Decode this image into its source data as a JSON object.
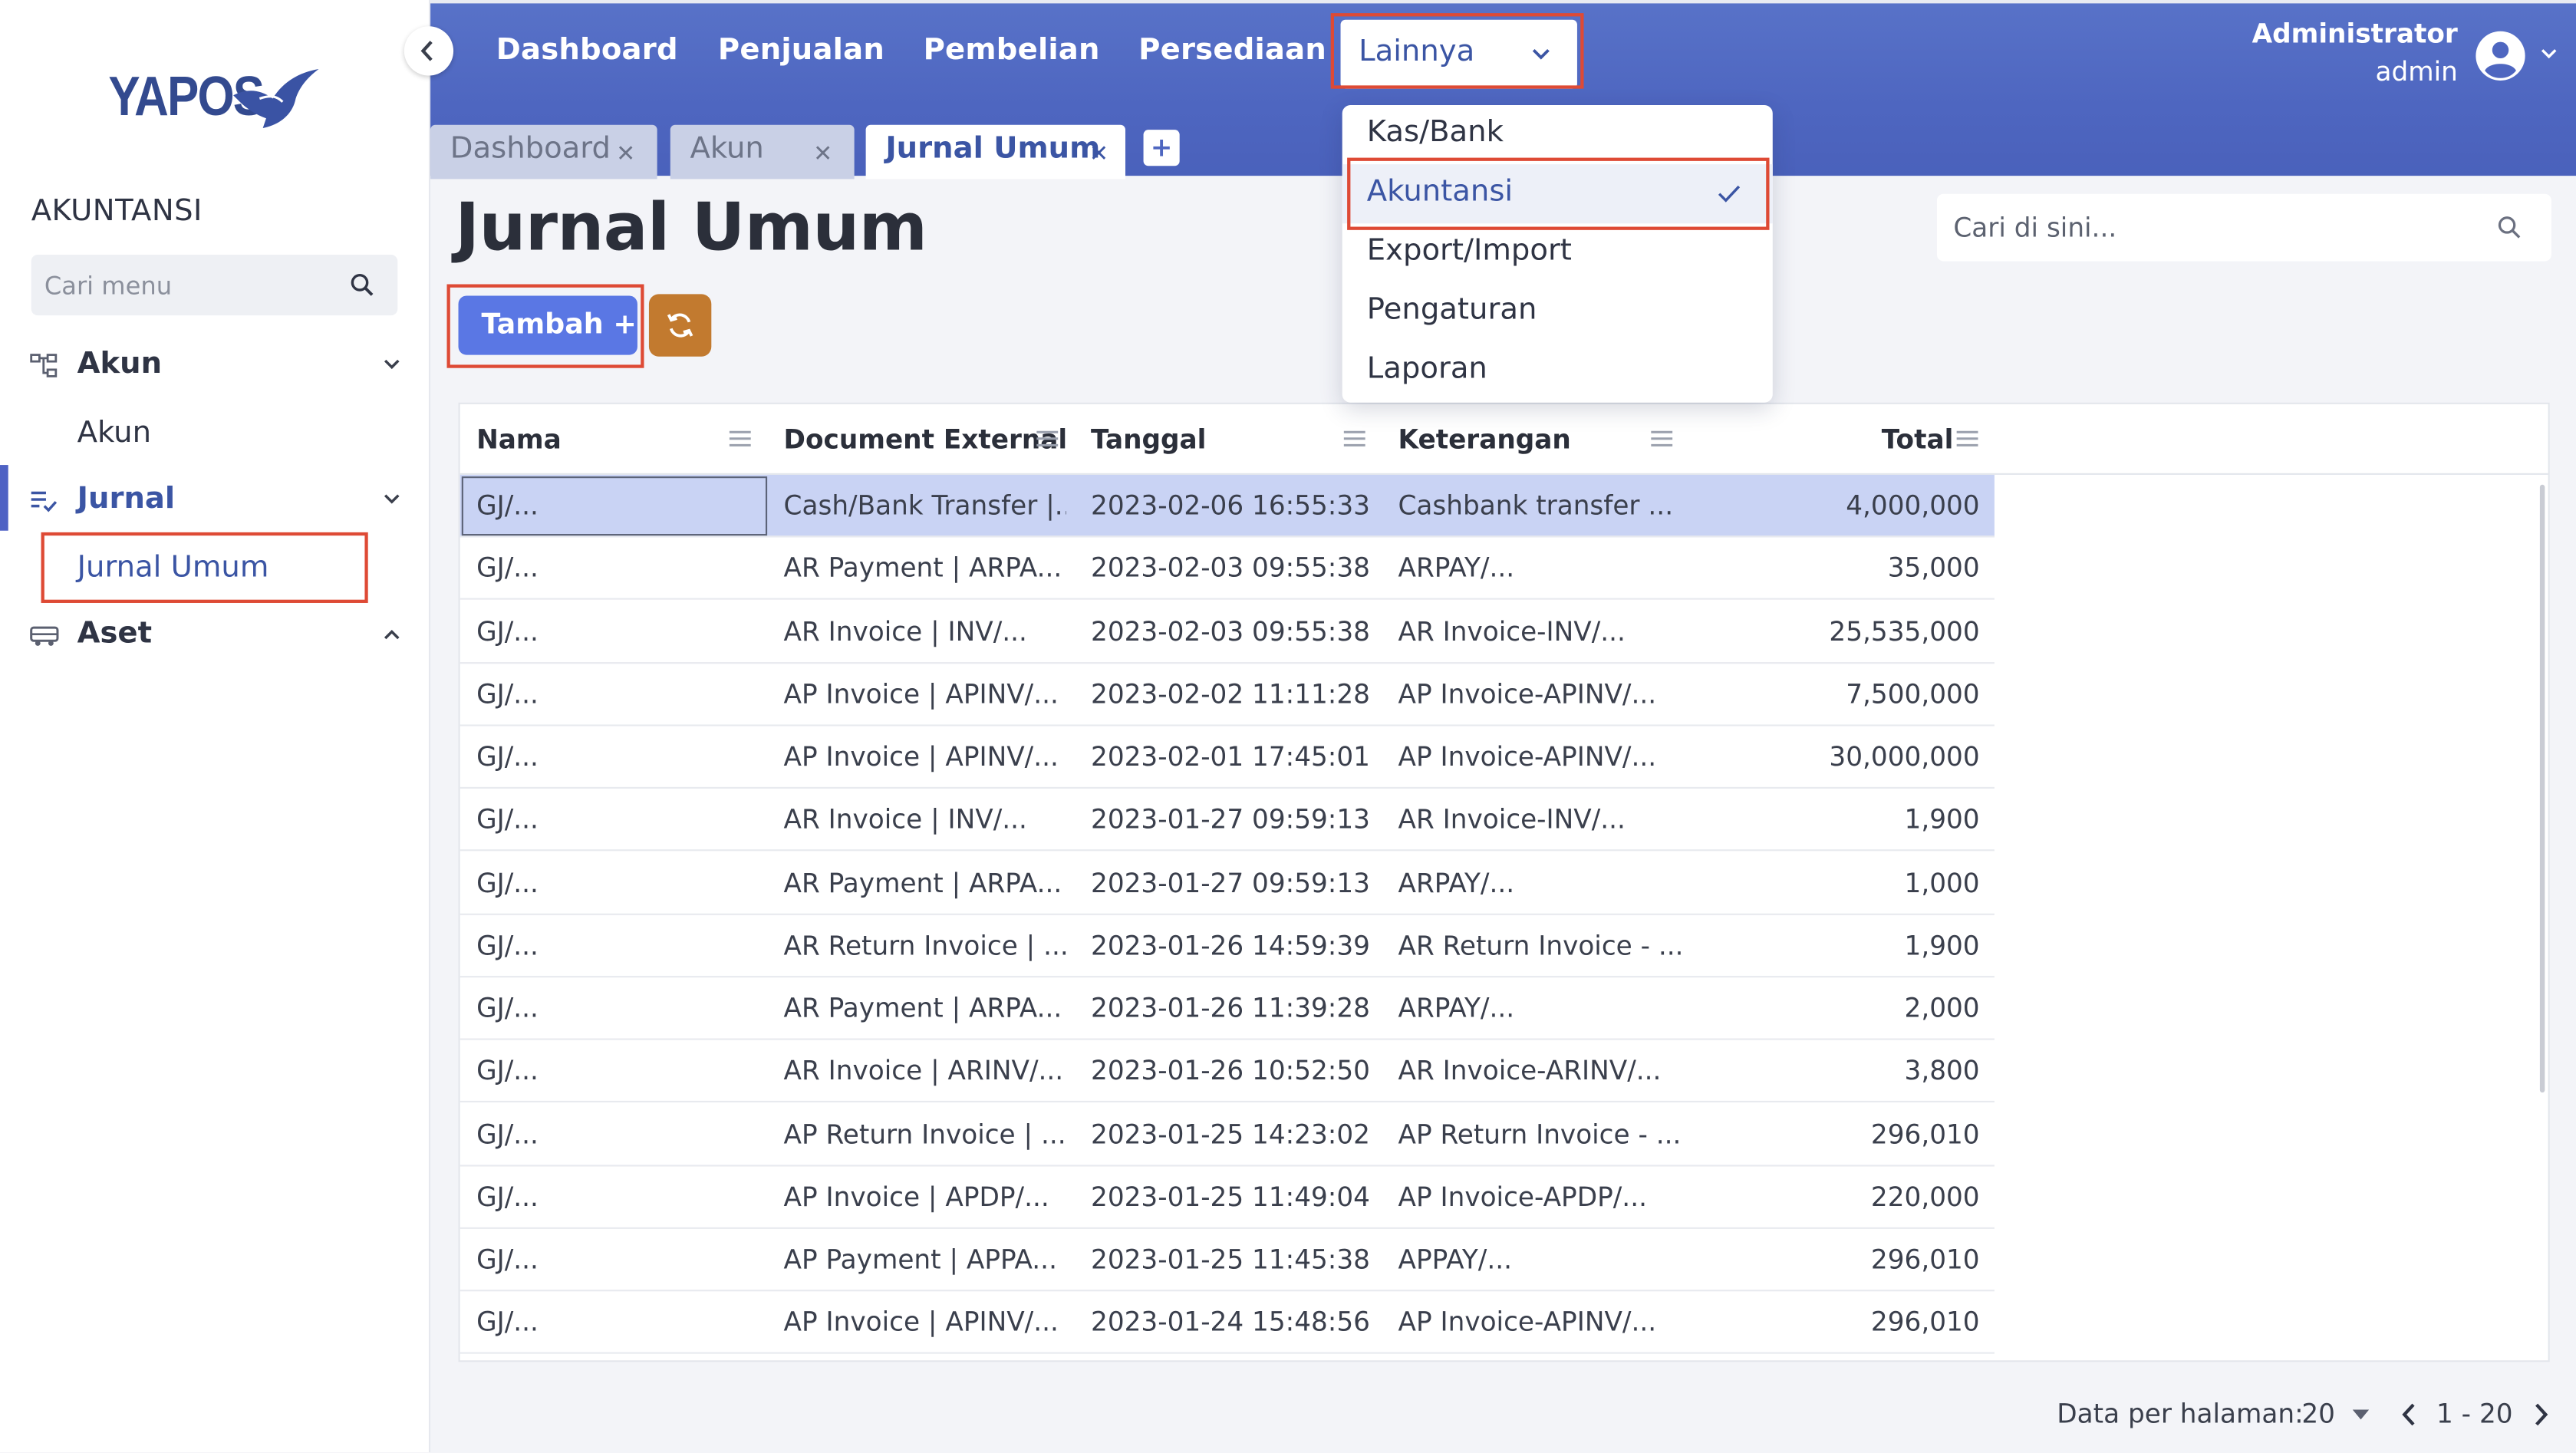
{
  "app": {
    "logo_text": "YAPOS",
    "accent_color": "#4e66c0",
    "highlight_color": "#de4a35"
  },
  "sidebar": {
    "section_title": "AKUNTANSI",
    "search_placeholder": "Cari menu",
    "groups": [
      {
        "label": "Akun",
        "icon": "account-tree-icon",
        "expanded": true,
        "items": [
          {
            "label": "Akun"
          }
        ]
      },
      {
        "label": "Jurnal",
        "icon": "journal-list-icon",
        "expanded": true,
        "active": true,
        "items": [
          {
            "label": "Jurnal Umum",
            "active": true
          }
        ]
      },
      {
        "label": "Aset",
        "icon": "vehicle-icon",
        "expanded": false,
        "items": []
      }
    ]
  },
  "topbar": {
    "nav": [
      "Dashboard",
      "Penjualan",
      "Pembelian",
      "Persediaan"
    ],
    "more_label": "Lainnya",
    "user": {
      "name": "Administrator",
      "role": "admin"
    }
  },
  "dropdown": {
    "items": [
      {
        "label": "Kas/Bank"
      },
      {
        "label": "Akuntansi",
        "selected": true
      },
      {
        "label": "Export/Import"
      },
      {
        "label": "Pengaturan"
      },
      {
        "label": "Laporan"
      }
    ]
  },
  "tabs": [
    {
      "label": "Dashboard",
      "active": false
    },
    {
      "label": "Akun",
      "active": false
    },
    {
      "label": "Jurnal Umum",
      "active": true
    }
  ],
  "main": {
    "title": "Jurnal Umum",
    "add_button": "Tambah +",
    "search_placeholder": "Cari di sini..."
  },
  "table": {
    "columns": [
      "Nama",
      "Document External",
      "Tanggal",
      "Keterangan",
      "Total"
    ],
    "rows": [
      [
        "GJ/...",
        "Cash/Bank Transfer |...",
        "2023-02-06 16:55:33",
        "Cashbank transfer ...",
        "4,000,000"
      ],
      [
        "GJ/...",
        "AR Payment | ARPA...",
        "2023-02-03 09:55:38",
        "ARPAY/...",
        "35,000"
      ],
      [
        "GJ/...",
        "AR Invoice | INV/...",
        "2023-02-03 09:55:38",
        "AR Invoice-INV/...",
        "25,535,000"
      ],
      [
        "GJ/...",
        "AP Invoice | APINV/...",
        "2023-02-02 11:11:28",
        "AP Invoice-APINV/...",
        "7,500,000"
      ],
      [
        "GJ/...",
        "AP Invoice | APINV/...",
        "2023-02-01 17:45:01",
        "AP Invoice-APINV/...",
        "30,000,000"
      ],
      [
        "GJ/...",
        "AR Invoice | INV/...",
        "2023-01-27 09:59:13",
        "AR Invoice-INV/...",
        "1,900"
      ],
      [
        "GJ/...",
        "AR Payment | ARPA...",
        "2023-01-27 09:59:13",
        "ARPAY/...",
        "1,000"
      ],
      [
        "GJ/...",
        "AR Return Invoice | ...",
        "2023-01-26 14:59:39",
        "AR Return Invoice - ...",
        "1,900"
      ],
      [
        "GJ/...",
        "AR Payment | ARPA...",
        "2023-01-26 11:39:28",
        "ARPAY/...",
        "2,000"
      ],
      [
        "GJ/...",
        "AR Invoice | ARINV/...",
        "2023-01-26 10:52:50",
        "AR Invoice-ARINV/...",
        "3,800"
      ],
      [
        "GJ/...",
        "AP Return Invoice | ...",
        "2023-01-25 14:23:02",
        "AP Return Invoice - ...",
        "296,010"
      ],
      [
        "GJ/...",
        "AP Invoice | APDP/...",
        "2023-01-25 11:49:04",
        "AP Invoice-APDP/...",
        "220,000"
      ],
      [
        "GJ/...",
        "AP Payment | APPA...",
        "2023-01-25 11:45:38",
        "APPAY/...",
        "296,010"
      ],
      [
        "GJ/...",
        "AP Invoice | APINV/...",
        "2023-01-24 15:48:56",
        "AP Invoice-APINV/...",
        "296,010"
      ]
    ]
  },
  "pager": {
    "label": "Data per halaman:",
    "size": "20",
    "range": "1 - 20"
  }
}
